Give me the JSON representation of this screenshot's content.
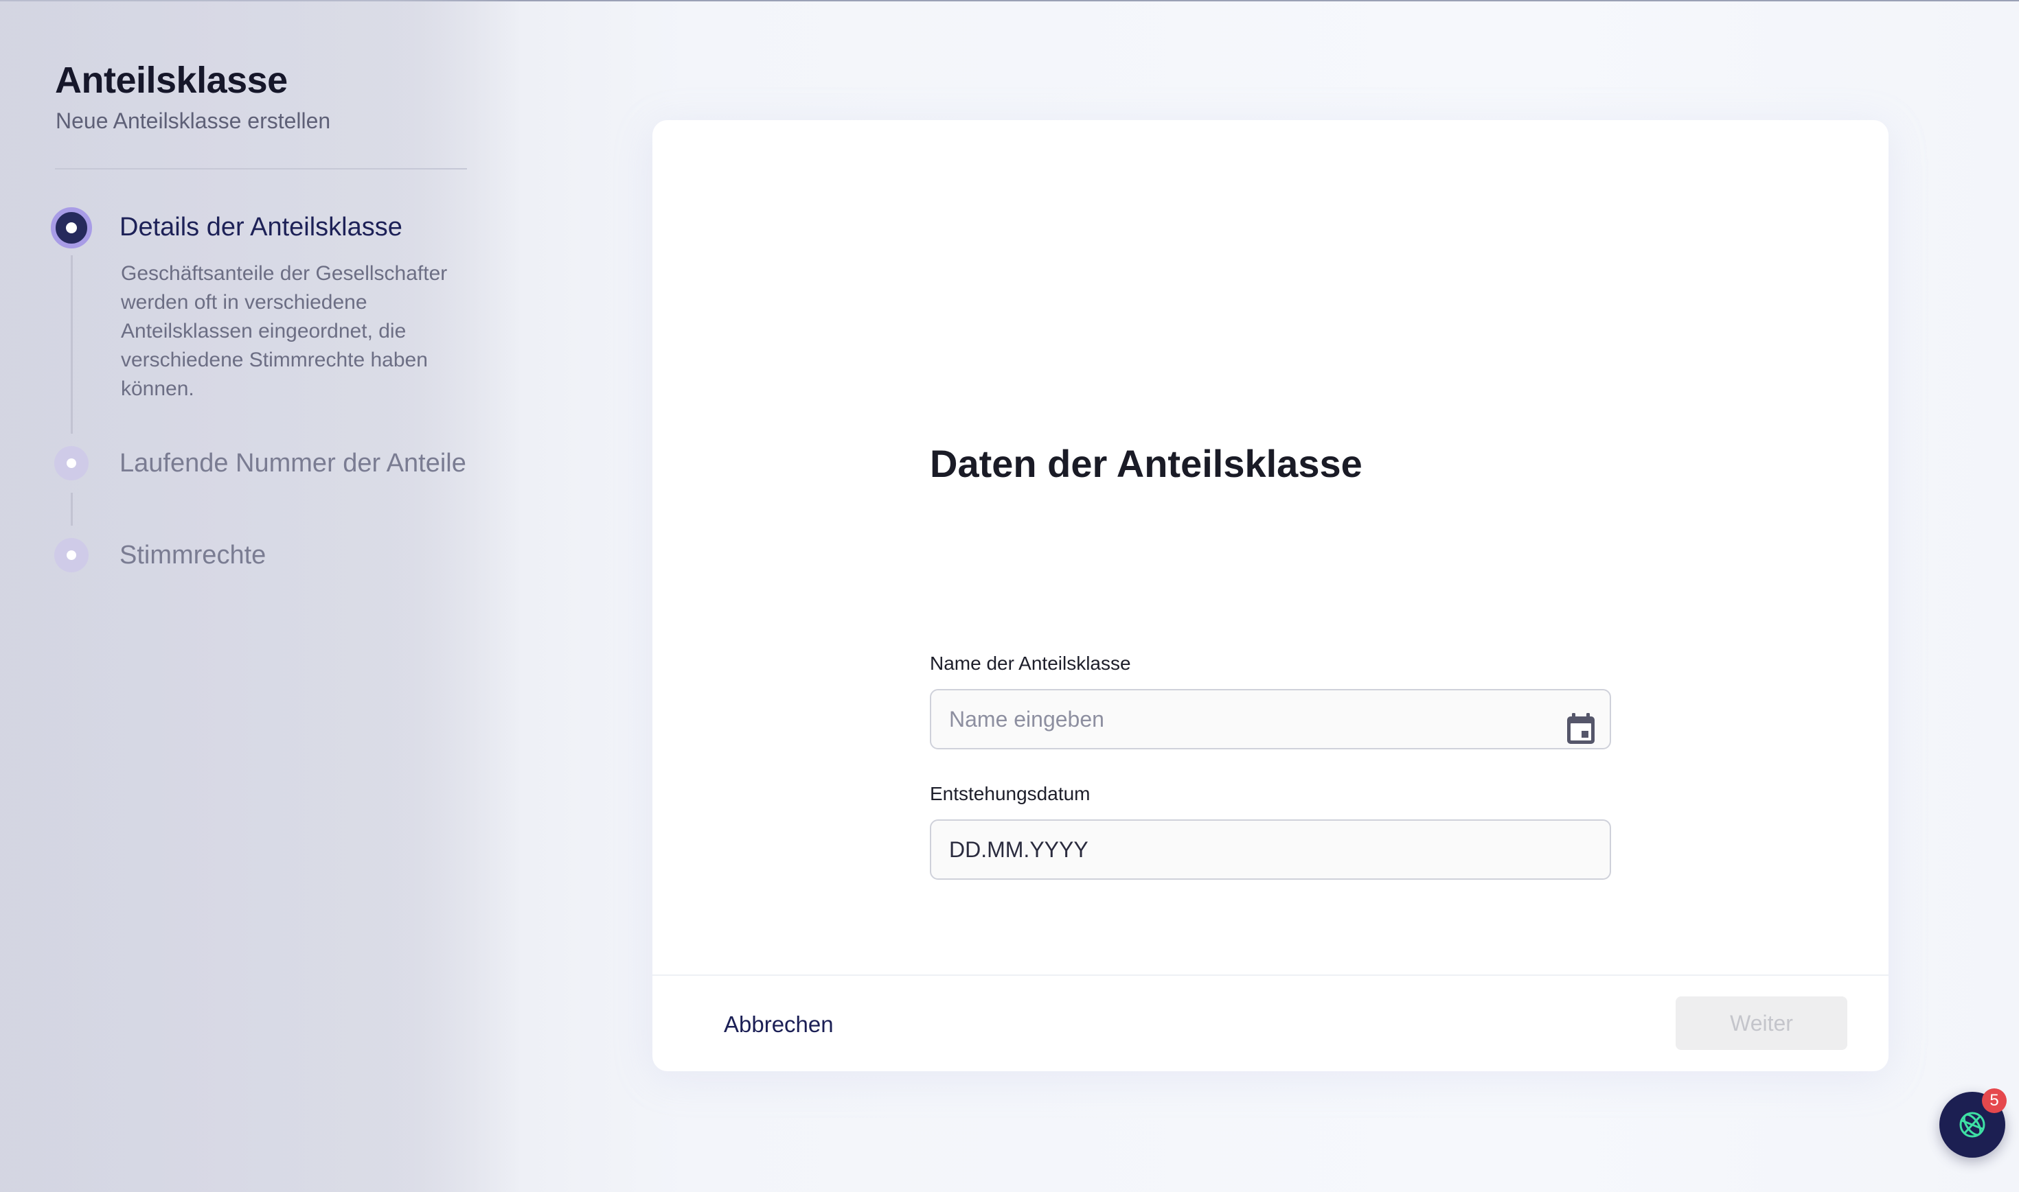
{
  "sidebar": {
    "title": "Anteilsklasse",
    "subtitle": "Neue Anteilsklasse erstellen",
    "steps": [
      {
        "label": "Details der Anteilsklasse",
        "state": "active",
        "description": "Geschäftsanteile der Gesellschafter werden oft in verschiedene Anteilsklassen eingeordnet, die verschiedene Stimmrechte haben können."
      },
      {
        "label": "Laufende Nummer der Anteile",
        "state": "pending"
      },
      {
        "label": "Stimmrechte",
        "state": "pending"
      }
    ]
  },
  "form": {
    "title": "Daten der Anteilsklasse",
    "name_label": "Name der Anteilsklasse",
    "name_placeholder": "Name eingeben",
    "name_value": "",
    "date_label": "Entstehungsdatum",
    "date_placeholder": "DD.MM.YYYY",
    "date_icon": "calendar-icon"
  },
  "footer": {
    "cancel_label": "Abbrechen",
    "next_label": "Weiter",
    "next_enabled": false
  },
  "help_widget": {
    "icon": "globe-icon",
    "badge_count": "5"
  },
  "colors": {
    "accent_dark": "#1c1f52",
    "step_active_ring": "#a89ce6",
    "step_pending": "#cfcbe8",
    "badge": "#e5484d"
  }
}
